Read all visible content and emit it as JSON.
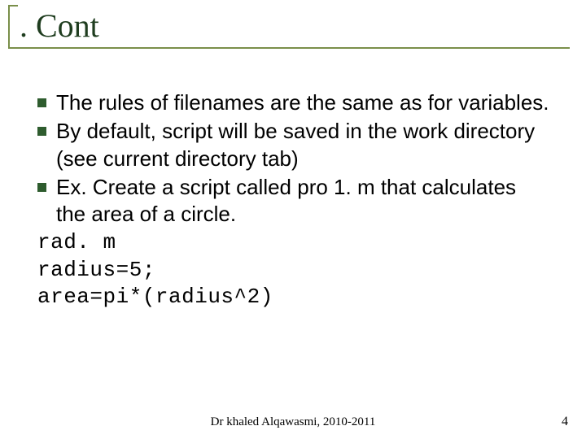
{
  "title": ". Cont",
  "bullets": [
    "The rules of filenames are the same as for variables.",
    "By default, script will be saved in the work directory (see current directory tab)",
    "Ex. Create a script called pro 1. m that calculates the area of a circle."
  ],
  "code_lines": [
    "rad. m",
    "radius=5;",
    "area=pi*(radius^2)"
  ],
  "footer": {
    "center": "Dr khaled Alqawasmi, 2010-2011",
    "page": "4"
  }
}
